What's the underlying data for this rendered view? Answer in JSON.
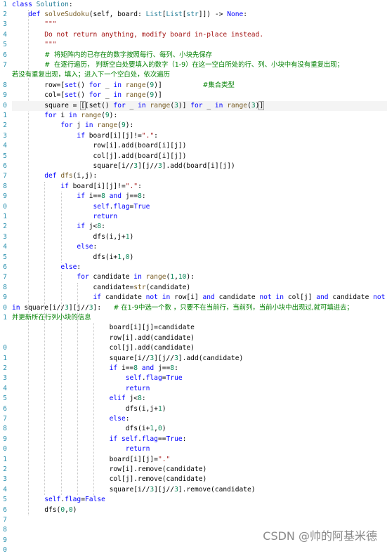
{
  "editor": {
    "line_numbers": [
      "1",
      "2",
      "3",
      "4",
      "5",
      "6",
      "7",
      "",
      "8",
      "9",
      "0",
      "1",
      "2",
      "3",
      "4",
      "5",
      "6",
      "7",
      "8",
      "9",
      "0",
      "1",
      "2",
      "3",
      "4",
      "5",
      "6",
      "7",
      "8",
      "9",
      "0",
      "1",
      "",
      "",
      "0",
      "1",
      "2",
      "3",
      "4",
      "5",
      "6",
      "7",
      "8",
      "9",
      "0",
      "1",
      "2",
      "3",
      "4",
      "5",
      "6",
      "7",
      "8",
      "9",
      "0"
    ],
    "lines": [
      [
        [
          "k",
          "class "
        ],
        [
          "tp",
          "Solution"
        ],
        [
          "n",
          ":"
        ]
      ],
      [
        [
          "n",
          "    "
        ],
        [
          "k",
          "def "
        ],
        [
          "fn",
          "solveSudoku"
        ],
        [
          "n",
          "(self, board: "
        ],
        [
          "tp",
          "List"
        ],
        [
          "n",
          "["
        ],
        [
          "tp",
          "List"
        ],
        [
          "n",
          "["
        ],
        [
          "tp",
          "str"
        ],
        [
          "n",
          "]]) -> "
        ],
        [
          "k",
          "None"
        ],
        [
          "n",
          ":"
        ]
      ],
      [
        [
          "n",
          "        "
        ],
        [
          "str",
          "\"\"\""
        ]
      ],
      [
        [
          "n",
          "        "
        ],
        [
          "str",
          "Do not return anything, modify board in-place instead."
        ]
      ],
      [
        [
          "n",
          "        "
        ],
        [
          "str",
          "\"\"\""
        ]
      ],
      [
        [
          "n",
          "        "
        ],
        [
          "c",
          "#  将矩阵内的已存在的数字按照每行、每列、小块先保存"
        ]
      ],
      [
        [
          "n",
          "        "
        ],
        [
          "c",
          "#  在逐行遍历， 判断空白处要填入的数字（1-9）在这一空白所处的行、列、小块中有没有重复出现；"
        ]
      ],
      [
        [
          "c",
          "若没有重复出现，填入；进入下一个空白处，依次遍历"
        ]
      ],
      [
        [
          "n",
          "        row=["
        ],
        [
          "k",
          "set"
        ],
        [
          "n",
          "() "
        ],
        [
          "k",
          "for "
        ],
        [
          "n",
          "_ "
        ],
        [
          "k",
          "in "
        ],
        [
          "fn",
          "range"
        ],
        [
          "n",
          "("
        ],
        [
          "num",
          "9"
        ],
        [
          "n",
          ")]          "
        ],
        [
          "c",
          "#集合类型"
        ]
      ],
      [
        [
          "n",
          "        col=["
        ],
        [
          "k",
          "set"
        ],
        [
          "n",
          "() "
        ],
        [
          "k",
          "for "
        ],
        [
          "n",
          "_ "
        ],
        [
          "k",
          "in "
        ],
        [
          "fn",
          "range"
        ],
        [
          "n",
          "("
        ],
        [
          "num",
          "9"
        ],
        [
          "n",
          ")]"
        ]
      ],
      [
        [
          "n",
          "        square = "
        ],
        [
          "bm",
          "["
        ],
        [
          "n",
          "[set() "
        ],
        [
          "k",
          "for "
        ],
        [
          "n",
          "_ "
        ],
        [
          "k",
          "in "
        ],
        [
          "fn",
          "range"
        ],
        [
          "n",
          "("
        ],
        [
          "num",
          "3"
        ],
        [
          "n",
          ")] "
        ],
        [
          "k",
          "for "
        ],
        [
          "n",
          "_ "
        ],
        [
          "k",
          "in "
        ],
        [
          "fn",
          "range"
        ],
        [
          "n",
          "("
        ],
        [
          "num",
          "3"
        ],
        [
          "n",
          ")"
        ],
        [
          "bm",
          "]"
        ]
      ],
      [
        [
          "n",
          "        "
        ],
        [
          "k",
          "for "
        ],
        [
          "n",
          "i "
        ],
        [
          "k",
          "in "
        ],
        [
          "fn",
          "range"
        ],
        [
          "n",
          "("
        ],
        [
          "num",
          "9"
        ],
        [
          "n",
          "):"
        ]
      ],
      [
        [
          "n",
          "            "
        ],
        [
          "k",
          "for "
        ],
        [
          "n",
          "j "
        ],
        [
          "k",
          "in "
        ],
        [
          "fn",
          "range"
        ],
        [
          "n",
          "("
        ],
        [
          "num",
          "9"
        ],
        [
          "n",
          "):"
        ]
      ],
      [
        [
          "n",
          "                "
        ],
        [
          "k",
          "if "
        ],
        [
          "n",
          "board[i][j]!="
        ],
        [
          "str",
          "\".\""
        ],
        [
          "n",
          ":"
        ]
      ],
      [
        [
          "n",
          "                    row[i].add(board[i][j])"
        ]
      ],
      [
        [
          "n",
          "                    col[j].add(board[i][j])"
        ]
      ],
      [
        [
          "n",
          "                    square[i//"
        ],
        [
          "num",
          "3"
        ],
        [
          "n",
          "][j//"
        ],
        [
          "num",
          "3"
        ],
        [
          "n",
          "].add(board[i][j])"
        ]
      ],
      [
        [
          "n",
          "        "
        ],
        [
          "k",
          "def "
        ],
        [
          "fn",
          "dfs"
        ],
        [
          "n",
          "(i,j):"
        ]
      ],
      [
        [
          "n",
          "            "
        ],
        [
          "k",
          "if "
        ],
        [
          "n",
          "board[i][j]!="
        ],
        [
          "str",
          "\".\""
        ],
        [
          "n",
          ":"
        ]
      ],
      [
        [
          "n",
          "                "
        ],
        [
          "k",
          "if "
        ],
        [
          "n",
          "i=="
        ],
        [
          "num",
          "8"
        ],
        [
          "n",
          " "
        ],
        [
          "k",
          "and "
        ],
        [
          "n",
          "j=="
        ],
        [
          "num",
          "8"
        ],
        [
          "n",
          ":"
        ]
      ],
      [
        [
          "n",
          "                    "
        ],
        [
          "k",
          "self"
        ],
        [
          "n",
          "."
        ],
        [
          "k",
          "flag"
        ],
        [
          "n",
          "="
        ],
        [
          "k",
          "True"
        ]
      ],
      [
        [
          "n",
          "                    "
        ],
        [
          "k",
          "return"
        ]
      ],
      [
        [
          "n",
          "                "
        ],
        [
          "k",
          "if "
        ],
        [
          "n",
          "j<"
        ],
        [
          "num",
          "8"
        ],
        [
          "n",
          ":"
        ]
      ],
      [
        [
          "n",
          "                    dfs(i,j+"
        ],
        [
          "num",
          "1"
        ],
        [
          "n",
          ")"
        ]
      ],
      [
        [
          "n",
          "                "
        ],
        [
          "k",
          "else"
        ],
        [
          "n",
          ":"
        ]
      ],
      [
        [
          "n",
          "                    dfs(i+"
        ],
        [
          "num",
          "1"
        ],
        [
          "n",
          ","
        ],
        [
          "num",
          "0"
        ],
        [
          "n",
          ")"
        ]
      ],
      [
        [
          "n",
          "            "
        ],
        [
          "k",
          "else"
        ],
        [
          "n",
          ":"
        ]
      ],
      [
        [
          "n",
          "                "
        ],
        [
          "k",
          "for "
        ],
        [
          "n",
          "candidate "
        ],
        [
          "k",
          "in "
        ],
        [
          "fn",
          "range"
        ],
        [
          "n",
          "("
        ],
        [
          "num",
          "1"
        ],
        [
          "n",
          ","
        ],
        [
          "num",
          "10"
        ],
        [
          "n",
          "):"
        ]
      ],
      [
        [
          "n",
          "                    candidate="
        ],
        [
          "fn",
          "str"
        ],
        [
          "n",
          "(candidate)"
        ]
      ],
      [
        [
          "n",
          "                    "
        ],
        [
          "k",
          "if "
        ],
        [
          "n",
          "candidate "
        ],
        [
          "k",
          "not in "
        ],
        [
          "n",
          "row[i] "
        ],
        [
          "k",
          "and "
        ],
        [
          "n",
          "candidate "
        ],
        [
          "k",
          "not in "
        ],
        [
          "n",
          "col[j] "
        ],
        [
          "k",
          "and "
        ],
        [
          "n",
          "candidate "
        ],
        [
          "k",
          "not"
        ]
      ],
      [
        [
          "k",
          "in "
        ],
        [
          "n",
          "square[i//"
        ],
        [
          "num",
          "3"
        ],
        [
          "n",
          "][j//"
        ],
        [
          "num",
          "3"
        ],
        [
          "n",
          "]:   "
        ],
        [
          "c",
          "# 在1-9中选一个数 ，只要不在当前行，当前列，当前小块中出现过,就可填进去；"
        ]
      ],
      [
        [
          "c",
          "并更新所在行列小块的信息"
        ]
      ],
      [
        [
          "n",
          "                        board[i][j]=candidate"
        ]
      ],
      [
        [
          "n",
          "                        row[i].add(candidate)"
        ]
      ],
      [
        [
          "n",
          "                        col[j].add(candidate)"
        ]
      ],
      [
        [
          "n",
          "                        square[i//"
        ],
        [
          "num",
          "3"
        ],
        [
          "n",
          "][j//"
        ],
        [
          "num",
          "3"
        ],
        [
          "n",
          "].add(candidate)"
        ]
      ],
      [
        [
          "n",
          "                        "
        ],
        [
          "k",
          "if "
        ],
        [
          "n",
          "i=="
        ],
        [
          "num",
          "8"
        ],
        [
          "n",
          " "
        ],
        [
          "k",
          "and "
        ],
        [
          "n",
          "j=="
        ],
        [
          "num",
          "8"
        ],
        [
          "n",
          ":"
        ]
      ],
      [
        [
          "n",
          "                            "
        ],
        [
          "k",
          "self"
        ],
        [
          "n",
          "."
        ],
        [
          "k",
          "flag"
        ],
        [
          "n",
          "="
        ],
        [
          "k",
          "True"
        ]
      ],
      [
        [
          "n",
          "                            "
        ],
        [
          "k",
          "return"
        ]
      ],
      [
        [
          "n",
          "                        "
        ],
        [
          "k",
          "elif "
        ],
        [
          "n",
          "j<"
        ],
        [
          "num",
          "8"
        ],
        [
          "n",
          ":"
        ]
      ],
      [
        [
          "n",
          "                            dfs(i,j+"
        ],
        [
          "num",
          "1"
        ],
        [
          "n",
          ")"
        ]
      ],
      [
        [
          "n",
          "                        "
        ],
        [
          "k",
          "else"
        ],
        [
          "n",
          ":"
        ]
      ],
      [
        [
          "n",
          "                            dfs(i+"
        ],
        [
          "num",
          "1"
        ],
        [
          "n",
          ","
        ],
        [
          "num",
          "0"
        ],
        [
          "n",
          ")"
        ]
      ],
      [
        [
          "n",
          "                        "
        ],
        [
          "k",
          "if "
        ],
        [
          "k",
          "self"
        ],
        [
          "n",
          "."
        ],
        [
          "k",
          "flag"
        ],
        [
          "n",
          "=="
        ],
        [
          "k",
          "True"
        ],
        [
          "n",
          ":"
        ]
      ],
      [
        [
          "n",
          "                            "
        ],
        [
          "k",
          "return"
        ]
      ],
      [
        [
          "n",
          "                        board[i][j]="
        ],
        [
          "str",
          "\".\""
        ]
      ],
      [
        [
          "n",
          "                        row[i].remove(candidate)"
        ]
      ],
      [
        [
          "n",
          "                        col[j].remove(candidate)"
        ]
      ],
      [
        [
          "n",
          "                        square[i//"
        ],
        [
          "num",
          "3"
        ],
        [
          "n",
          "][j//"
        ],
        [
          "num",
          "3"
        ],
        [
          "n",
          "].remove(candidate)"
        ]
      ],
      [
        [
          "n",
          "        "
        ],
        [
          "k",
          "self"
        ],
        [
          "n",
          "."
        ],
        [
          "k",
          "flag"
        ],
        [
          "n",
          "="
        ],
        [
          "k",
          "False"
        ]
      ],
      [
        [
          "n",
          "        dfs("
        ],
        [
          "num",
          "0"
        ],
        [
          "n",
          ","
        ],
        [
          "num",
          "0"
        ],
        [
          "n",
          ")"
        ]
      ],
      [],
      [],
      [],
      []
    ]
  },
  "watermark": "CSDN @帅的阿基米德",
  "colors": {
    "keyword": "#0000ff",
    "string": "#a31515",
    "comment": "#008000",
    "line_number": "#2b91af"
  }
}
